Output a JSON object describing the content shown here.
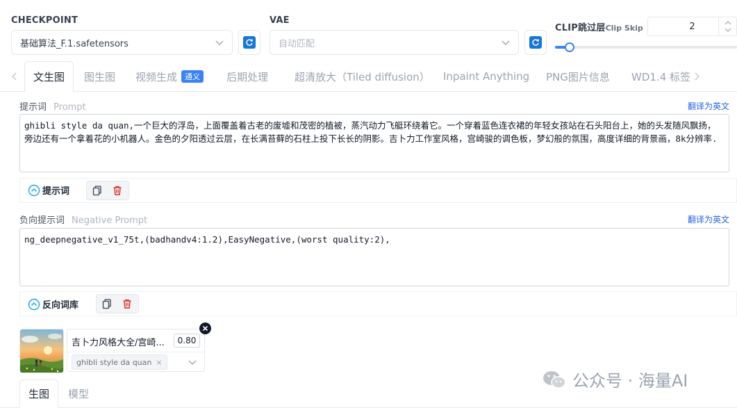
{
  "header": {
    "checkpoint_label": "CHECKPOINT",
    "checkpoint_value": "基础算法_F.1.safetensors",
    "vae_label": "VAE",
    "vae_placeholder": "自动匹配",
    "clip_label": "CLIP跳过层",
    "clip_label_en": "Clip Skip",
    "clip_value": "2",
    "clip_slider_fraction": 0.08
  },
  "tabs": [
    {
      "label": "文生图",
      "active": true
    },
    {
      "label": "图生图"
    },
    {
      "label": "视频生成",
      "badge": "通义"
    },
    {
      "label": "后期处理"
    },
    {
      "label": "超清放大（Tiled diffusion）"
    },
    {
      "label": "Inpaint Anything"
    },
    {
      "label": "PNG图片信息"
    },
    {
      "label": "WD1.4 标签"
    }
  ],
  "prompt": {
    "label": "提示词",
    "label_en": "Prompt",
    "translate": "翻译为英文",
    "value": "ghibli style da quan,一个巨大的浮岛，上面覆盖着古老的废墟和茂密的植被，蒸汽动力飞艇环绕着它。一个穿着蓝色连衣裙的年轻女孩站在石头阳台上，她的头发随风飘扬，旁边还有一个拿着花的小机器人。金色的夕阳透过云层，在长满苔藓的石柱上投下长长的阴影。吉卜力工作室风格，宫崎骏的调色板，梦幻般的氛围，高度详细的背景画，8k分辨率.",
    "library_label": "提示词"
  },
  "negative": {
    "label": "负向提示词",
    "label_en": "Negative Prompt",
    "translate": "翻译为英文",
    "value": "ng_deepnegative_v1_75t,(badhandv4:1.2),EasyNegative,(worst quality:2),",
    "library_label": "反向词库"
  },
  "lora": {
    "name": "吉卜力风格大全/宫崎...",
    "weight": "0.80",
    "trigger": "ghibli style da quan"
  },
  "bottom_tabs": [
    {
      "label": "生图",
      "active": true
    },
    {
      "label": "模型"
    }
  ],
  "watermark": "公众号 · 海量AI"
}
